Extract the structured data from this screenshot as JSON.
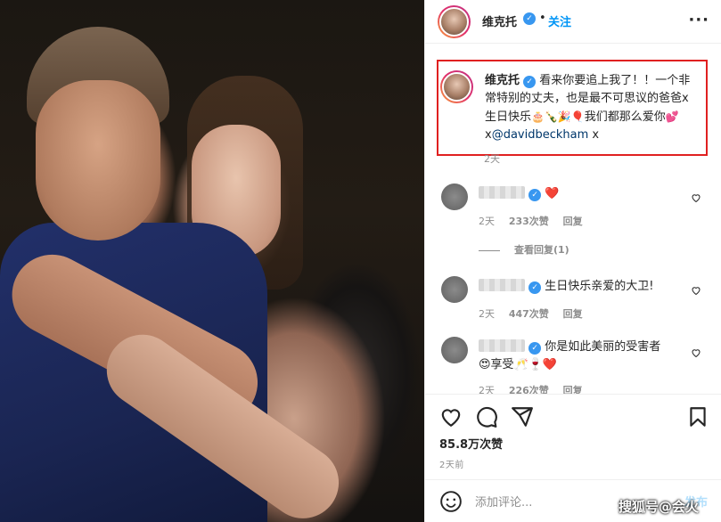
{
  "post": {
    "username": "维克托",
    "follow_label": "关注",
    "dot": "•",
    "more_label": "···"
  },
  "caption": {
    "username": "维克托",
    "text_part1": "看来你要追上我了！！一个非常特别的丈夫，也是最不可思议的爸爸x生日快乐",
    "emojis1": "🎂🍾🎉🎈",
    "text_part2": "我们都那么爱你",
    "emojis2": "💕",
    "text_part3": "x",
    "mention": "@davidbeckham",
    "text_part4": " x",
    "time": "2天"
  },
  "comments": [
    {
      "text": "❤️",
      "time": "2天",
      "likes": "233次赞",
      "reply": "回复"
    },
    {
      "text": "生日快乐亲爱的大卫!",
      "time": "2天",
      "likes": "447次赞",
      "reply": "回复"
    },
    {
      "text": "你是如此美丽的受害者😍享受🥂🍷❤️",
      "time": "2天",
      "likes": "226次赞",
      "reply": "回复"
    }
  ],
  "view_replies": "查看回复(1)",
  "likes_count": "85.8万次赞",
  "posted_time": "2天前",
  "add_comment": {
    "placeholder": "添加评论...",
    "post_label": "发布"
  },
  "watermark": "搜狐号@会火",
  "colors": {
    "accent": "#0095f6",
    "highlight_border": "#e02020",
    "verified": "#3897f0"
  }
}
